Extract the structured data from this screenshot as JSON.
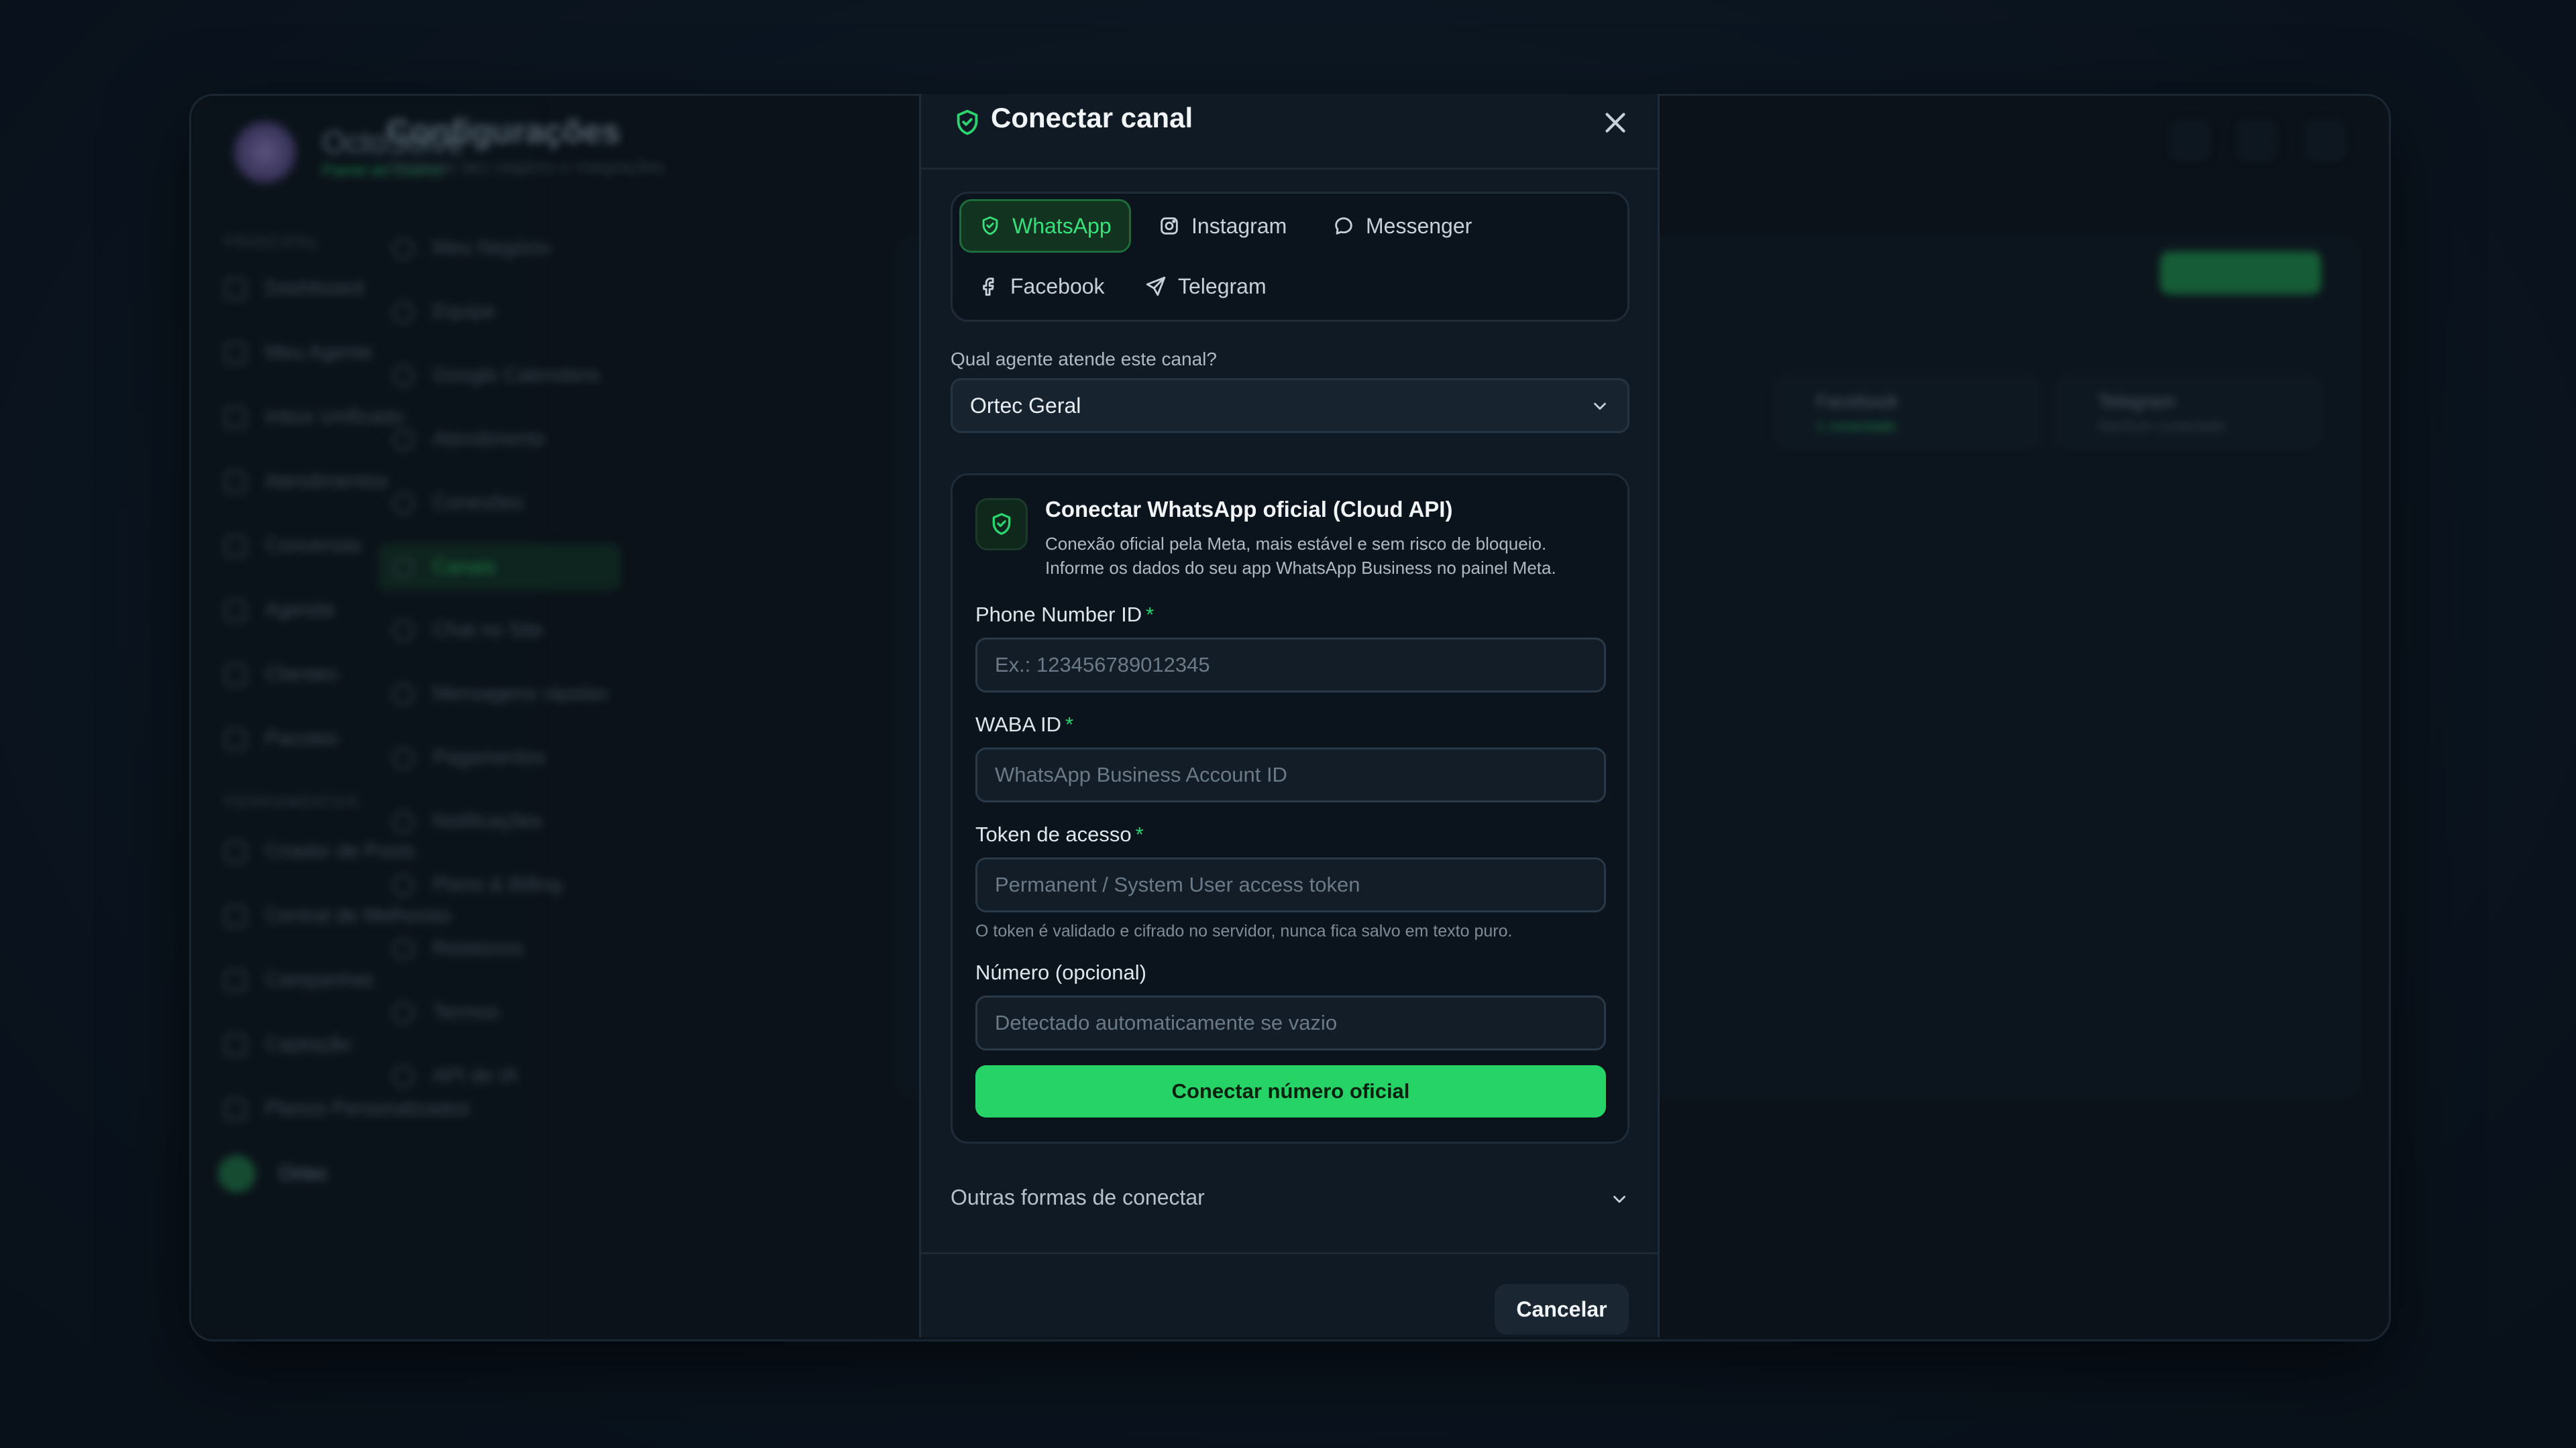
{
  "background": {
    "brand": "OctoSolve",
    "brand_sub": "Painel do Cliente",
    "sections": [
      "PRINCIPAL",
      "FERRAMENTAS"
    ],
    "nav_main": [
      "Dashboard",
      "Meu Agente",
      "Inbox Unificado",
      "Atendimentos",
      "Conversas",
      "Agenda",
      "Clientes",
      "Pacotes"
    ],
    "nav_tools": [
      "Criador de Posts",
      "Central de Melhorias",
      "Campanhas",
      "Captação",
      "Planos Personalizados"
    ],
    "user_name": "Ortec",
    "settings_title": "Configurações",
    "settings_subtitle": "Gerencie seu negócio e integrações",
    "settings_nav": [
      "Meu Negócio",
      "Equipe",
      "Google Calendário",
      "Atendimento",
      "Conexões",
      "Canais",
      "Chat no Site",
      "Mensagens rápidas",
      "Pagamentos",
      "Notificações",
      "Plano & Billing",
      "Relatórios",
      "Termos",
      "API de IA"
    ],
    "cards": [
      {
        "label": "Facebook",
        "sub": "1 conectado"
      },
      {
        "label": "Telegram",
        "sub": "Nenhum conectado"
      }
    ]
  },
  "modal": {
    "title": "Conectar canal",
    "tabs": {
      "whatsapp": "WhatsApp",
      "instagram": "Instagram",
      "messenger": "Messenger",
      "facebook": "Facebook",
      "telegram": "Telegram"
    },
    "active_tab": "whatsapp",
    "agent_question": "Qual agente atende este canal?",
    "agent_selected": "Ortec Geral",
    "card": {
      "title": "Conectar WhatsApp oficial (Cloud API)",
      "description": "Conexão oficial pela Meta, mais estável e sem risco de bloqueio. Informe os dados do seu app WhatsApp Business no painel Meta.",
      "phone_label": "Phone Number ID",
      "phone_placeholder": "Ex.: 123456789012345",
      "waba_label": "WABA ID",
      "waba_placeholder": "WhatsApp Business Account ID",
      "token_label": "Token de acesso",
      "token_placeholder": "Permanent / System User access token",
      "token_hint": "O token é validado e cifrado no servidor, nunca fica salvo em texto puro.",
      "number_label": "Número (opcional)",
      "number_placeholder": "Detectado automaticamente se vazio",
      "required_mark": "*",
      "submit": "Conectar número oficial"
    },
    "other_ways": "Outras formas de conectar",
    "cancel": "Cancelar"
  },
  "colors": {
    "accent": "#25d366",
    "accent_text": "#38e07c",
    "modal_bg": "#0f1a25",
    "page_bg": "#0b1520"
  }
}
